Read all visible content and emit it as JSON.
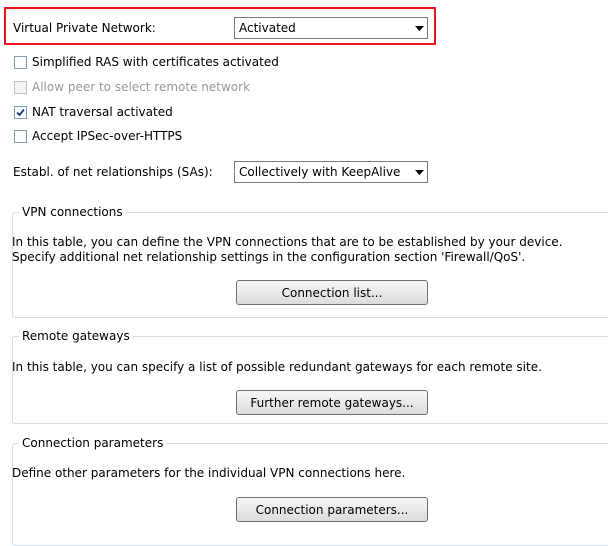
{
  "vpn": {
    "label": "Virtual Private Network:",
    "value": "Activated"
  },
  "checkboxes": [
    {
      "label": "Simplified RAS with certificates activated",
      "checked": false,
      "disabled": false
    },
    {
      "label": "Allow peer to select remote network",
      "checked": false,
      "disabled": true
    },
    {
      "label": "NAT traversal activated",
      "checked": true,
      "disabled": false
    },
    {
      "label": "Accept IPSec-over-HTTPS",
      "checked": false,
      "disabled": false
    }
  ],
  "sa": {
    "label": "Establ. of net relationships (SAs):",
    "value": "Collectively with KeepAlive"
  },
  "groups": {
    "vpn_connections": {
      "title": "VPN connections",
      "line1": "In this table, you can define the VPN connections that are to be established by your device.",
      "line2": "Specify additional net relationship settings in the configuration section 'Firewall/QoS'.",
      "button": "Connection list..."
    },
    "remote_gateways": {
      "title": "Remote gateways",
      "line1": "In this table, you can specify a list of possible redundant gateways for each remote site.",
      "button": "Further remote gateways..."
    },
    "connection_parameters": {
      "title": "Connection parameters",
      "line1": "Define other parameters for the individual VPN connections here.",
      "button": "Connection parameters..."
    }
  },
  "colors": {
    "highlight": "#e8141e",
    "checkbox_border": "#7f9db9",
    "group_border": "#d5dfe5"
  }
}
